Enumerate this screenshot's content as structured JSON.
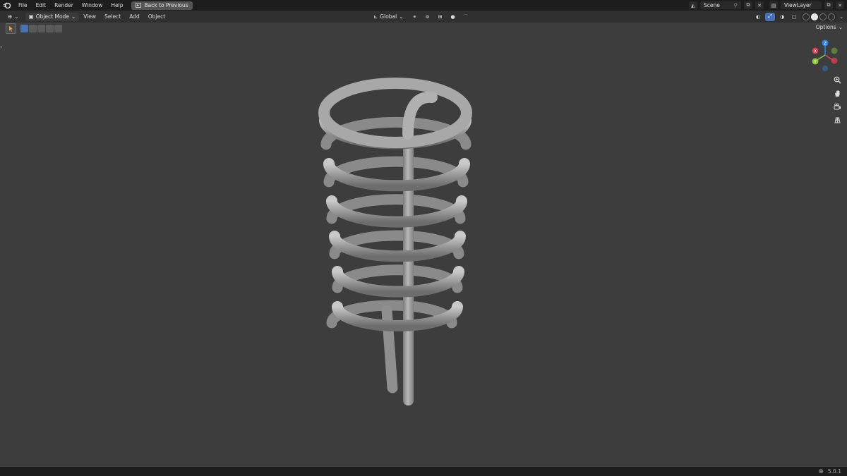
{
  "topbar": {
    "menus": [
      "File",
      "Edit",
      "Render",
      "Window",
      "Help"
    ],
    "back_label": "Back to Previous",
    "scene": "Scene",
    "view_layer": "ViewLayer"
  },
  "header": {
    "mode": "Object Mode",
    "menus": [
      "View",
      "Select",
      "Add",
      "Object"
    ],
    "orientation": "Global",
    "options": "Options"
  },
  "gizmo": {
    "x": "X",
    "y": "Y",
    "z": "Z"
  },
  "status": {
    "version": "5.0.1"
  },
  "viewport": {
    "object": "coil-spring-tube"
  },
  "colors": {
    "accent": "#4772b3",
    "x_axis": "#e63e53",
    "y_axis": "#8bc53f",
    "z_axis": "#2f84e3"
  }
}
